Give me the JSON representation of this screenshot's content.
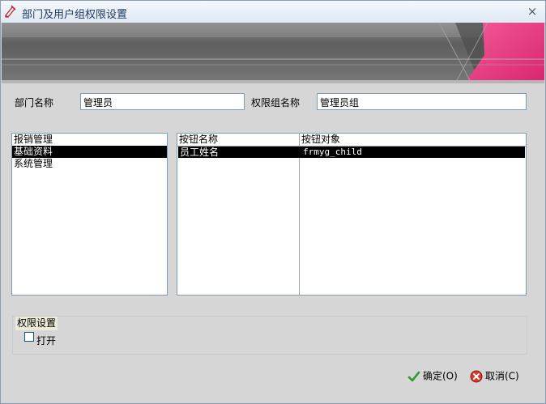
{
  "window": {
    "title": "部门及用户组权限设置",
    "close_glyph": "×"
  },
  "form": {
    "dept_label": "部门名称",
    "dept_value": "管理员",
    "group_label": "权限组名称",
    "group_value": "管理员组"
  },
  "modules": {
    "items": [
      "报销管理",
      "基础资料",
      "系统管理"
    ],
    "selected": "基础资料"
  },
  "buttons_grid": {
    "columns": [
      "按钮名称",
      "按钮对象"
    ],
    "rows": [
      [
        "员工姓名",
        "frmyg_child"
      ]
    ]
  },
  "permission": {
    "group_title": "权限设置",
    "open_label": "打开",
    "open_checked": false
  },
  "actions": {
    "ok_label": "确定(O)",
    "cancel_label": "取消(C)"
  },
  "icons": {
    "app": "edit-pen-icon",
    "ok": "checkmark-icon",
    "cancel": "cancel-circle-icon"
  },
  "colors": {
    "selection": "#000000",
    "accent_pink": "#e8317a",
    "banner_gray": "#6e6e6e"
  }
}
